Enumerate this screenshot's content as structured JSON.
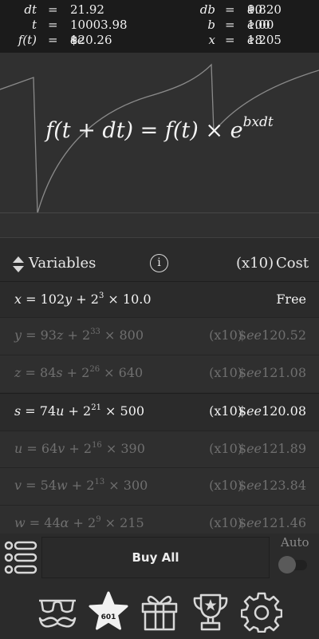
{
  "stats": {
    "left": [
      {
        "name": "dt",
        "eq": "=",
        "value": "21.92"
      },
      {
        "name": "t",
        "eq": "=",
        "value": "10003.98"
      },
      {
        "name": "f(t)",
        "eq": "=",
        "value_prefix": "$",
        "value_italic": "ee",
        "value_rest": "120.26"
      }
    ],
    "right": [
      {
        "name": "db",
        "eq": "=",
        "value_pre": "1.820",
        "value_italic": "e",
        "value_rest": "90"
      },
      {
        "name": "b",
        "eq": "=",
        "value_pre": "1.00",
        "value_italic": "e",
        "value_rest": "100"
      },
      {
        "name": "x",
        "eq": "=",
        "value_pre": "1.205",
        "value_italic": "e",
        "value_rest": "18"
      }
    ]
  },
  "equation": {
    "lhs": "f(t + dt) = f(t) × e",
    "exponent": "bxdt"
  },
  "header": {
    "title": "Variables",
    "info": "i",
    "mult": "(x10)",
    "cost": "Cost"
  },
  "rows": [
    {
      "var": "x",
      "coef": "102",
      "next": "y",
      "base": "2",
      "exp": "3",
      "factor": "10.0",
      "mult": "",
      "price": "Free",
      "price_italic": "",
      "price_rest": "",
      "state": "active"
    },
    {
      "var": "y",
      "coef": "93",
      "next": "z",
      "base": "2",
      "exp": "33",
      "factor": "800",
      "mult": "(x10)",
      "price": "$",
      "price_italic": "ee",
      "price_rest": "120.52",
      "state": "dim"
    },
    {
      "var": "z",
      "coef": "84",
      "next": "s",
      "base": "2",
      "exp": "26",
      "factor": "640",
      "mult": "(x10)",
      "price": "$",
      "price_italic": "ee",
      "price_rest": "121.08",
      "state": "dim"
    },
    {
      "var": "s",
      "coef": "74",
      "next": "u",
      "base": "2",
      "exp": "21",
      "factor": "500",
      "mult": "(x10)",
      "price": "$",
      "price_italic": "ee",
      "price_rest": "120.08",
      "state": "active"
    },
    {
      "var": "u",
      "coef": "64",
      "next": "v",
      "base": "2",
      "exp": "16",
      "factor": "390",
      "mult": "(x10)",
      "price": "$",
      "price_italic": "ee",
      "price_rest": "121.89",
      "state": "dim"
    },
    {
      "var": "v",
      "coef": "54",
      "next": "w",
      "base": "2",
      "exp": "13",
      "factor": "300",
      "mult": "(x10)",
      "price": "$",
      "price_italic": "ee",
      "price_rest": "123.84",
      "state": "dim"
    },
    {
      "var": "w",
      "coef": "44",
      "next": "α",
      "base": "2",
      "exp": "9",
      "factor": "215",
      "mult": "(x10)",
      "price": "$",
      "price_italic": "ee",
      "price_rest": "121.46",
      "state": "dim"
    }
  ],
  "controls": {
    "buy_all": "Buy All",
    "auto_label": "Auto",
    "auto_enabled": false
  },
  "nav": {
    "items": [
      {
        "name": "disguise",
        "icon": "glasses-mustache-icon"
      },
      {
        "name": "stars",
        "icon": "star-icon",
        "count": "601"
      },
      {
        "name": "gifts",
        "icon": "gift-icon"
      },
      {
        "name": "achievements",
        "icon": "trophy-icon"
      },
      {
        "name": "settings",
        "icon": "gear-icon"
      }
    ]
  },
  "colors": {
    "background": "#2b2b2b",
    "stats_background": "#1b1b1b",
    "text": "#e8e8e8",
    "dim_text": "#6f6f6f",
    "graph_line": "#8a8a8a"
  }
}
